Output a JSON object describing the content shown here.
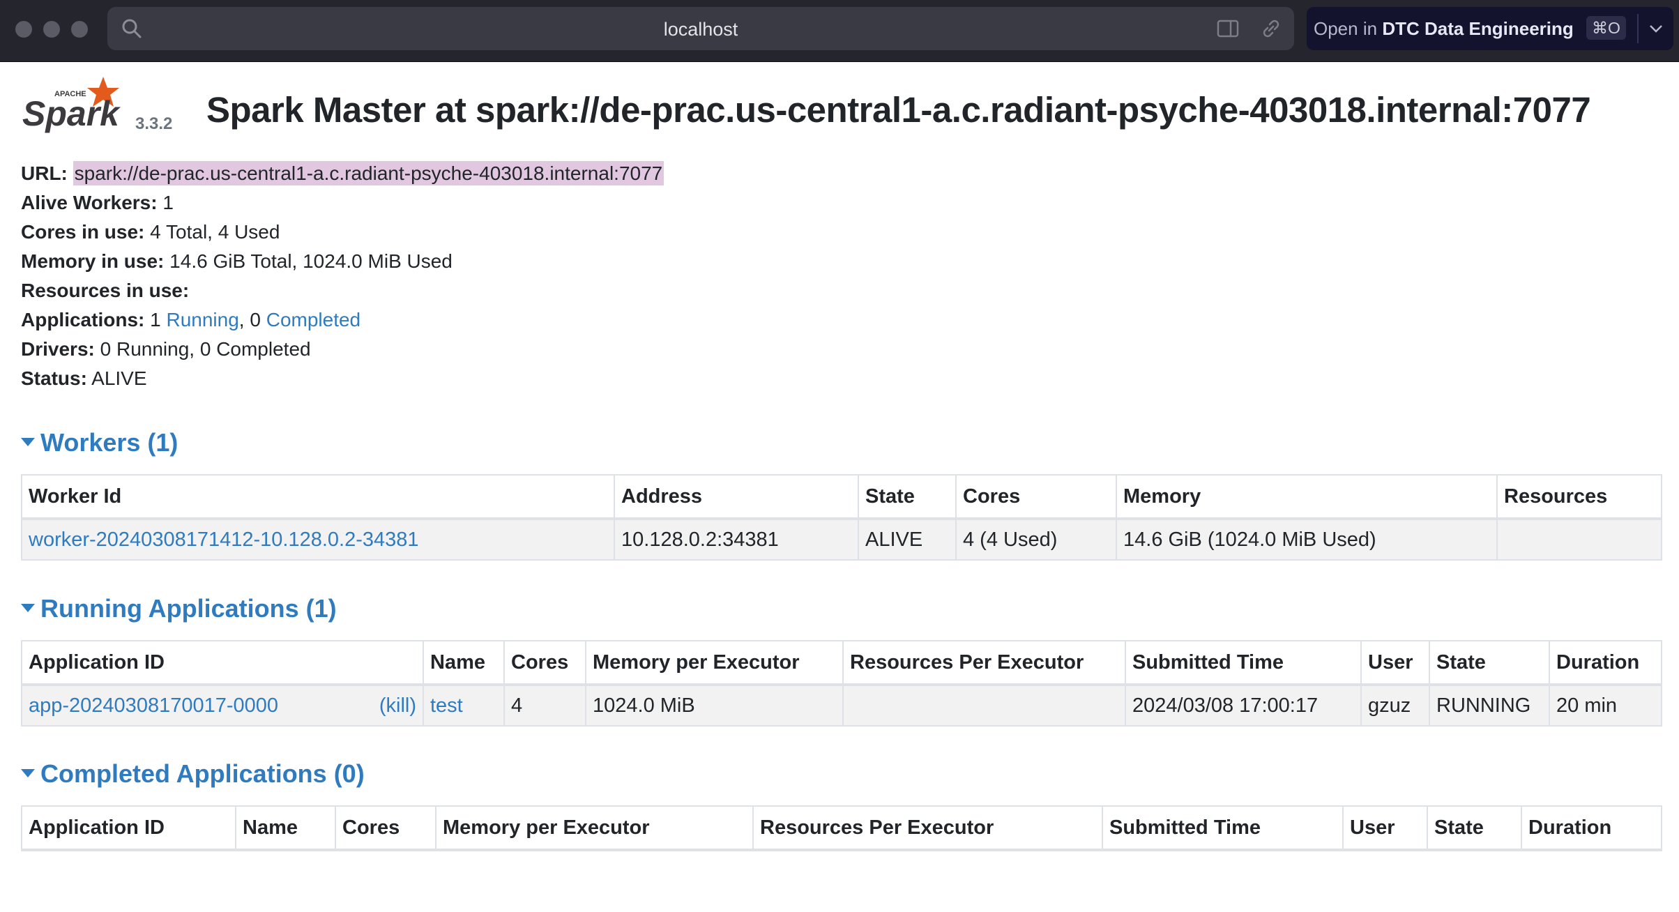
{
  "browser": {
    "url": "localhost",
    "open_in_prefix": "Open in",
    "open_in_app": "DTC Data Engineering",
    "shortcut": "⌘O"
  },
  "header": {
    "logo_text": "Spark",
    "logo_apache": "APACHE",
    "version": "3.3.2",
    "title": "Spark Master at spark://de-prac.us-central1-a.c.radiant-psyche-403018.internal:7077"
  },
  "summary": {
    "url_label": "URL:",
    "url_value": "spark://de-prac.us-central1-a.c.radiant-psyche-403018.internal:7077",
    "alive_workers_label": "Alive Workers:",
    "alive_workers_value": " 1",
    "cores_label": "Cores in use:",
    "cores_value": " 4 Total, 4 Used",
    "memory_label": "Memory in use:",
    "memory_value": " 14.6 GiB Total, 1024.0 MiB Used",
    "resources_label": "Resources in use:",
    "applications_label": "Applications:",
    "applications_running_count": " 1 ",
    "applications_running_link": "Running",
    "applications_sep": ", 0 ",
    "applications_completed_link": "Completed",
    "drivers_label": "Drivers:",
    "drivers_value": " 0 Running, 0 Completed",
    "status_label": "Status:",
    "status_value": " ALIVE"
  },
  "workers": {
    "heading": "Workers (1)",
    "columns": [
      "Worker Id",
      "Address",
      "State",
      "Cores",
      "Memory",
      "Resources"
    ],
    "rows": [
      {
        "id": "worker-20240308171412-10.128.0.2-34381",
        "address": "10.128.0.2:34381",
        "state": "ALIVE",
        "cores": "4 (4 Used)",
        "memory": "14.6 GiB (1024.0 MiB Used)",
        "resources": ""
      }
    ]
  },
  "running_apps": {
    "heading": "Running Applications (1)",
    "columns": [
      "Application ID",
      "Name",
      "Cores",
      "Memory per Executor",
      "Resources Per Executor",
      "Submitted Time",
      "User",
      "State",
      "Duration"
    ],
    "rows": [
      {
        "id": "app-20240308170017-0000",
        "kill": "(kill)",
        "name": "test",
        "cores": "4",
        "memory": "1024.0 MiB",
        "resources": "",
        "submitted": "2024/03/08 17:00:17",
        "user": "gzuz",
        "state": "RUNNING",
        "duration": "20 min"
      }
    ]
  },
  "completed_apps": {
    "heading": "Completed Applications (0)",
    "columns": [
      "Application ID",
      "Name",
      "Cores",
      "Memory per Executor",
      "Resources Per Executor",
      "Submitted Time",
      "User",
      "State",
      "Duration"
    ]
  }
}
